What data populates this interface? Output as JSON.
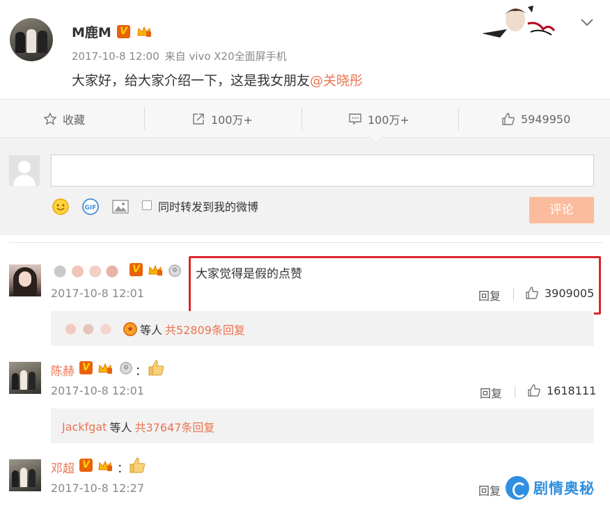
{
  "post": {
    "author": "M鹿M",
    "time": "2017-10-8 12:00",
    "source": "来自 vivo X20全面屏手机",
    "text": "大家好，给大家介绍一下，这是我女朋友",
    "mention": "@关晓彤"
  },
  "actions": {
    "favorite": "收藏",
    "forward_count": "100万+",
    "comment_count": "100万+",
    "like_count": "5949950"
  },
  "composer": {
    "input_value": "",
    "forward_label": "同时转发到我的微博",
    "forward_checked": false,
    "submit_label": "评论"
  },
  "comments": [
    {
      "author": "",
      "time": "2017-10-8 12:01",
      "text": "大家觉得是假的点赞",
      "reply_label": "回复",
      "likes": "3909005",
      "replies": {
        "names": "",
        "suffix": "等人",
        "count_text": "共52809条回复"
      }
    },
    {
      "author": "陈赫",
      "time": "2017-10-8 12:01",
      "text": "：",
      "reply_label": "回复",
      "likes": "1618111",
      "replies": {
        "names": "Jackfgat",
        "suffix": "等人",
        "count_text": "共37647条回复"
      }
    },
    {
      "author": "邓超",
      "time": "2017-10-8 12:27",
      "text": "：",
      "reply_label": "回复"
    }
  ],
  "watermark": {
    "text": "剧情奥秘"
  },
  "colors": {
    "accent": "#eb7350",
    "highlight": "#d9262c",
    "submit": "#fbbc9d"
  },
  "icons": [
    "chevron-down-icon",
    "star-icon",
    "forward-icon",
    "comment-icon",
    "thumb-up-icon",
    "emoji-icon",
    "gif-icon",
    "image-icon"
  ]
}
